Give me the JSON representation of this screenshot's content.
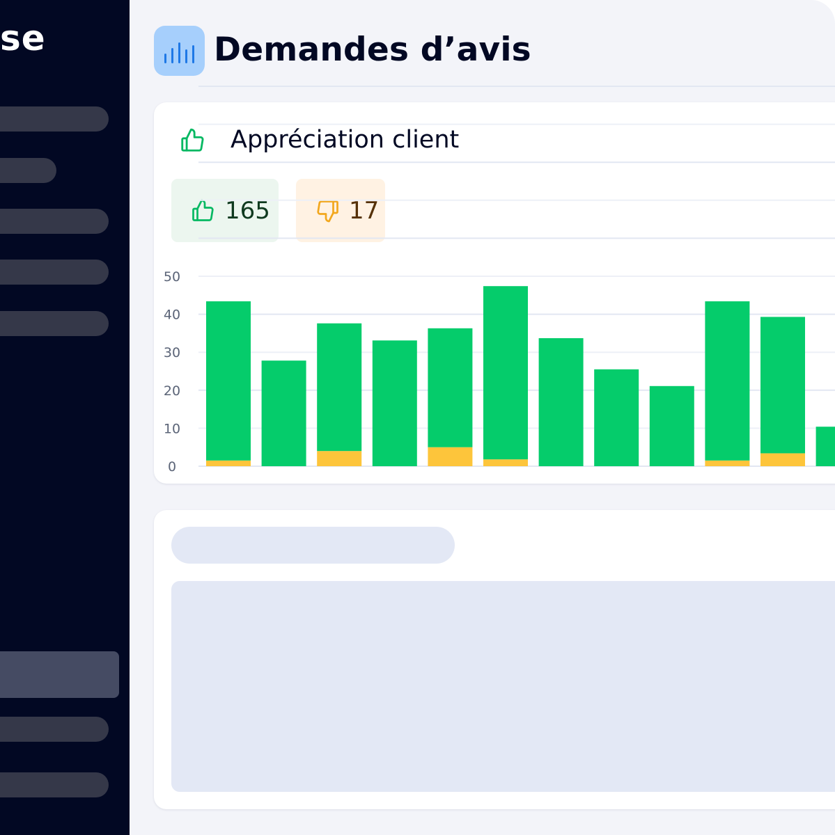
{
  "sidebar": {
    "brand_fragment": "se",
    "nav_items": 5,
    "bottom_items": 3
  },
  "header": {
    "title": "Demandes d’avis",
    "icon": "bar-chart-icon"
  },
  "appreciation_card": {
    "title": "Appréciation client",
    "icon": "thumbs-up-icon",
    "positive": {
      "icon": "thumbs-up-icon",
      "value": "165"
    },
    "negative": {
      "icon": "thumbs-down-icon",
      "value": "17"
    }
  },
  "colors": {
    "sidebar_bg": "#020823",
    "positive": "#05cc6b",
    "negative": "#fdc53b",
    "icon_green": "#05b862",
    "icon_yellow": "#f2a71d",
    "accent_blue": "#1e78e6"
  },
  "chart_data": {
    "type": "bar",
    "stacked": true,
    "y_ticks": [
      "0",
      "10",
      "20",
      "30",
      "40",
      "50"
    ],
    "ylim": [
      0,
      50
    ],
    "grid": true,
    "series": [
      {
        "color": "#fdc53b",
        "values": [
          1.5,
          0,
          4,
          0,
          5,
          1.8,
          0,
          0,
          0,
          1.5,
          3.4,
          0
        ]
      },
      {
        "color": "#05cc6b",
        "values": [
          41.9,
          27.8,
          33.6,
          33.1,
          31.3,
          45.6,
          33.7,
          25.5,
          21.1,
          41.9,
          35.9,
          10.4
        ]
      }
    ]
  },
  "placeholder_card": {}
}
